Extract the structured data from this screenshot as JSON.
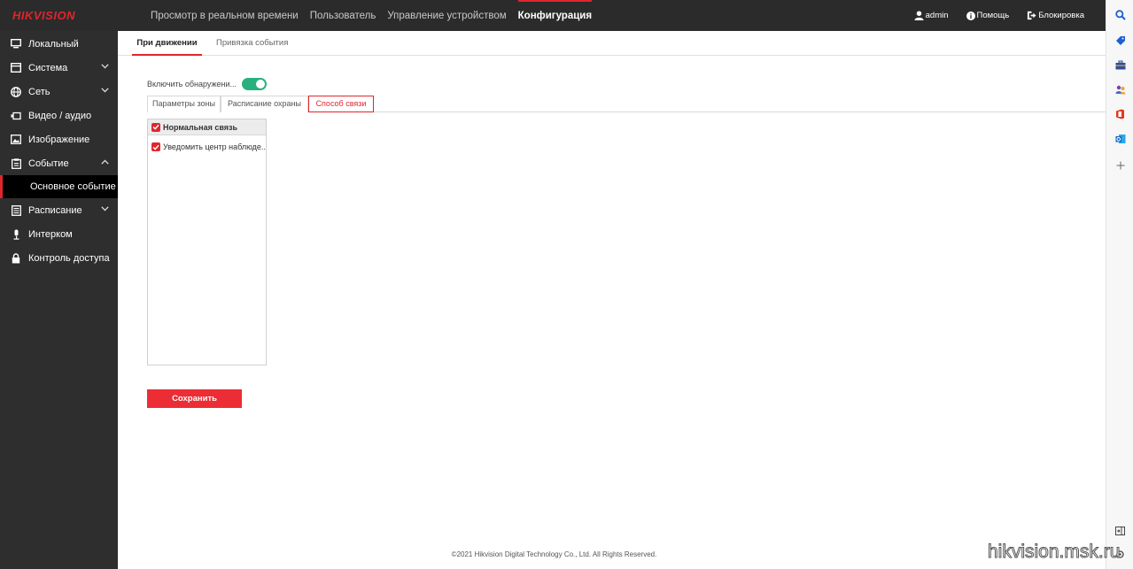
{
  "brand": {
    "logo": "HIKVISION",
    "accent_color": "#e0262c"
  },
  "top_nav": {
    "items": [
      {
        "label": "Просмотр в реальном времени"
      },
      {
        "label": "Пользователь"
      },
      {
        "label": "Управление устройством"
      },
      {
        "label": "Конфигурация"
      }
    ],
    "active_index": 3
  },
  "top_right": {
    "user": {
      "label": "admin",
      "icon": "user-icon"
    },
    "help": {
      "label": "Помощь",
      "icon": "info-icon"
    },
    "logout": {
      "label": "Блокировка",
      "icon": "logout-icon"
    }
  },
  "sidebar": {
    "items": [
      {
        "label": "Локальный",
        "icon": "monitor-icon"
      },
      {
        "label": "Система",
        "icon": "system-icon",
        "chevron": "down"
      },
      {
        "label": "Сеть",
        "icon": "globe-icon",
        "chevron": "down"
      },
      {
        "label": "Видео / аудио",
        "icon": "video-icon"
      },
      {
        "label": "Изображение",
        "icon": "image-icon"
      },
      {
        "label": "Событие",
        "icon": "event-icon",
        "chevron": "up"
      },
      {
        "label": "Расписание",
        "icon": "schedule-icon",
        "chevron": "down"
      },
      {
        "label": "Интерком",
        "icon": "microphone-icon"
      },
      {
        "label": "Контроль доступа",
        "icon": "lock-icon"
      }
    ],
    "sub_item": {
      "label": "Основное событие",
      "parent": "Событие"
    }
  },
  "main": {
    "tabs": [
      {
        "label": "При движении"
      },
      {
        "label": "Привязка события"
      }
    ],
    "active_tab": 0,
    "enable": {
      "label": "Включить обнаружени...",
      "on": true
    },
    "inner_tabs": [
      {
        "label": "Параметры зоны"
      },
      {
        "label": "Расписание охраны"
      },
      {
        "label": "Способ связи"
      }
    ],
    "active_inner_tab": 2,
    "linkage": {
      "group": {
        "label": "Нормальная связь",
        "checked": true
      },
      "items": [
        {
          "label": "Уведомить центр наблюде...",
          "checked": true
        }
      ]
    },
    "save_label": "Сохранить"
  },
  "footer": {
    "copyright": "©2021 Hikvision Digital Technology Co., Ltd. All Rights Reserved."
  },
  "watermark": "hikvision.msk.ru"
}
